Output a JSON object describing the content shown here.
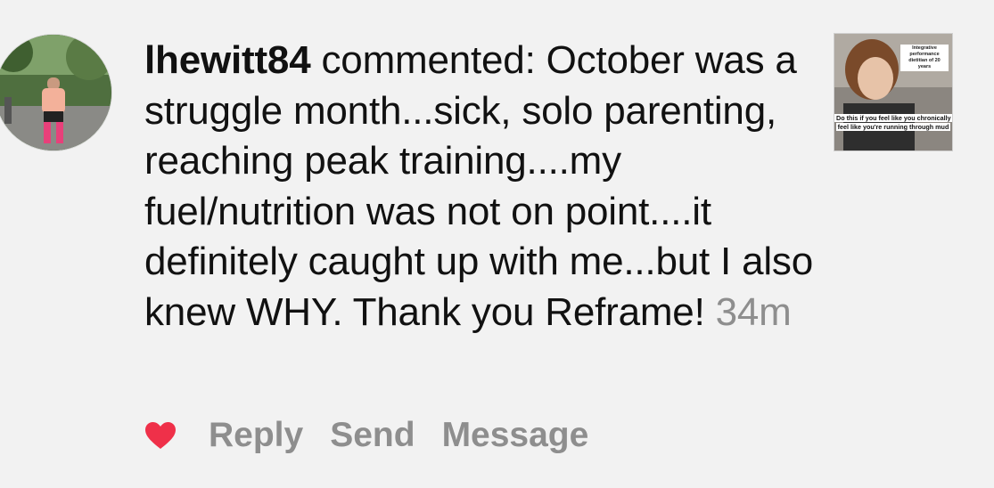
{
  "comment": {
    "username": "lhewitt84",
    "text": " commented: October was a struggle month...sick, solo parenting, reaching peak training....my fuel/nutrition was not on point....it definitely caught up with me...but I also knew WHY. Thank you Reframe!",
    "time": "34m"
  },
  "thumbnail": {
    "top_text": "Integrative performance dietitian of 20 years",
    "caption": "Do this if you feel like you chronically feel like you're running through mud"
  },
  "actions": {
    "reply": "Reply",
    "send": "Send",
    "message": "Message"
  },
  "icons": {
    "heart": "heart-icon-filled",
    "heart_color": "#ef3049"
  }
}
